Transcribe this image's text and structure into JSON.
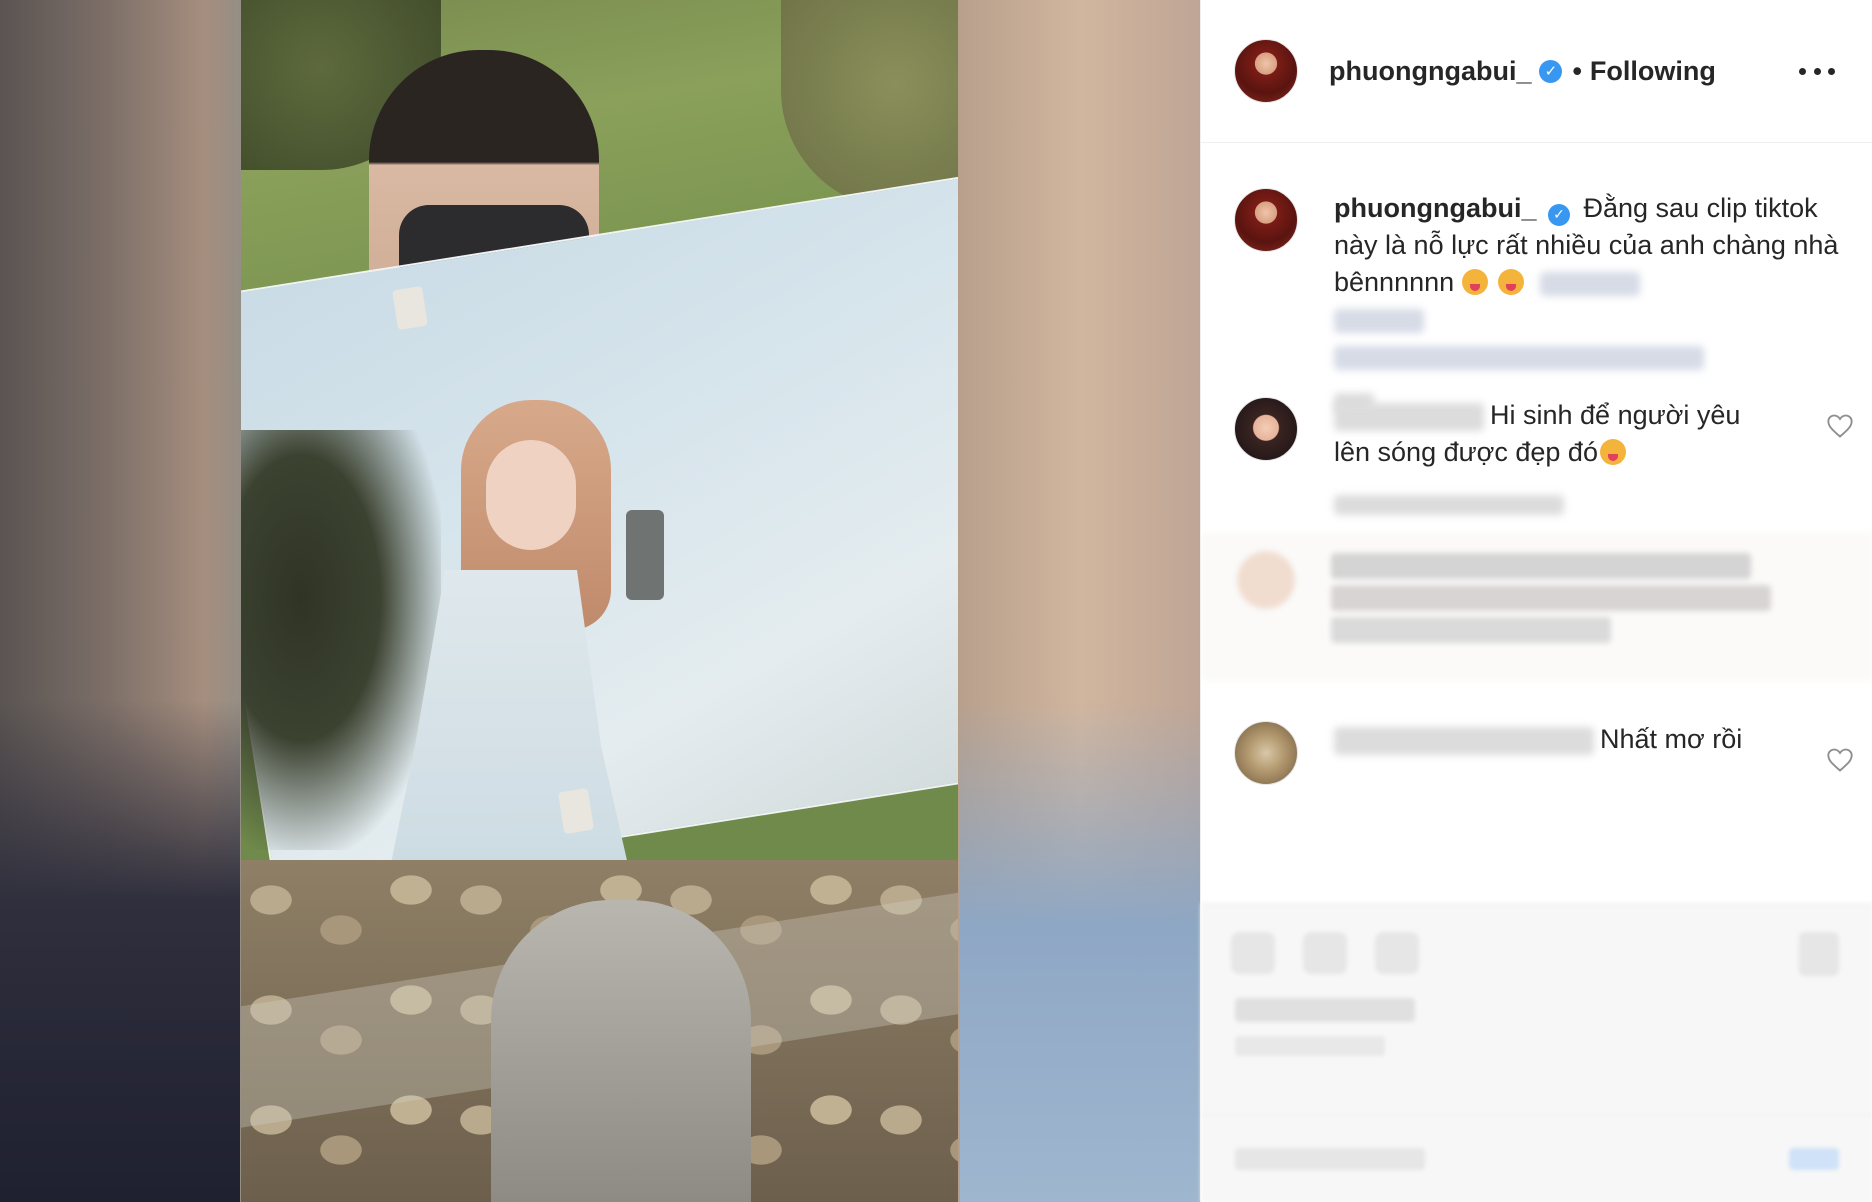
{
  "post": {
    "username": "phuongngabui_",
    "verified_icon": "verified-badge-icon",
    "separator": "•",
    "follow_status": "Following",
    "more_icon": "more-options-icon"
  },
  "caption": {
    "username": "phuongngabui_",
    "text": "Đằng sau clip tiktok này là nỗ lực rất nhiều của anh chàng nhà bênnnnnn"
  },
  "comments": [
    {
      "text_line1": "Hi sinh để người yêu",
      "text_line2": "lên sóng được đẹp đó",
      "emoji_icon": "kiss-emoji-icon"
    },
    {
      "text": "Nhất mơ rồi"
    }
  ],
  "colors": {
    "verified": "#3897f0",
    "text": "#262626",
    "border": "#efefef"
  }
}
